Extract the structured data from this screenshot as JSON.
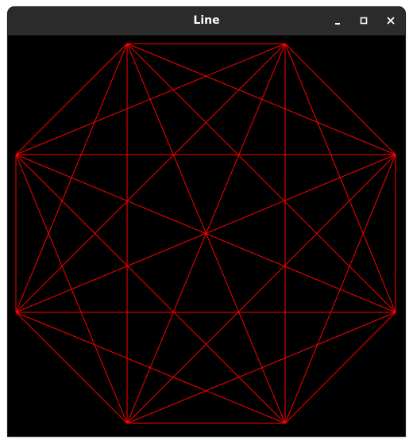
{
  "window": {
    "title": "Line"
  },
  "controls": {
    "minimize_icon": "minimize-icon",
    "maximize_icon": "maximize-icon",
    "close_icon": "close-icon"
  },
  "drawing": {
    "shape": "octagon with all diagonals",
    "line_color": "#ff0000",
    "background_color": "#000000",
    "vertex_count": 8
  }
}
